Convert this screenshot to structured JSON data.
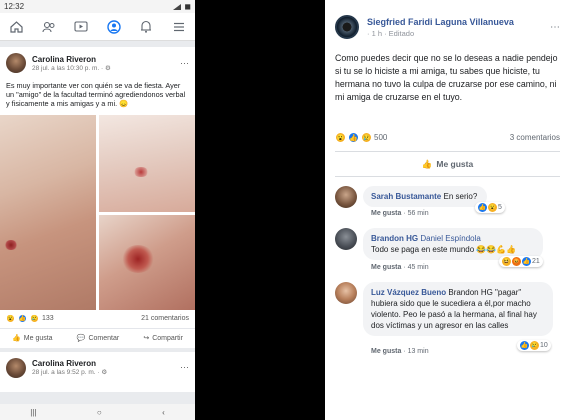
{
  "left": {
    "status": {
      "time": "12:32",
      "battery": "◼"
    },
    "nav": [
      "home-icon",
      "friends-icon",
      "watch-icon",
      "profile-icon",
      "notifications-icon",
      "menu-icon"
    ],
    "post": {
      "author": "Carolina Riveron",
      "time": "28 jul. a las 10:30 p. m. · ⚙",
      "text": "Es muy importante ver con quién se va de fiesta. Ayer un \"amigo\" de la facultad terminó agrediendonos verbal y fisicamente a mis amigas y a mi. 😞",
      "reaction_count": "133",
      "comments": "21 comentarios",
      "actions": {
        "like": "Me gusta",
        "comment": "Comentar",
        "share": "Compartir"
      }
    },
    "post2": {
      "author": "Carolina Riveron",
      "time": "28 jul. a las 9:52 p. m. · ⚙"
    }
  },
  "right": {
    "author": "Siegfried Faridi Laguna Villanueva",
    "time": "· 1 h · Editado",
    "text": "Como puedes decir que no se lo deseas a nadie pendejo si tu se lo hiciste a mi amiga, tu sabes que hiciste, tu hermana no tuvo la culpa de cruzarse por ese camino, ni mi amiga de cruzarse en el tuyo.",
    "reaction_count": "500",
    "comments_count": "3 comentarios",
    "like_label": "Me gusta",
    "comments": [
      {
        "name": "Sarah Bustamante",
        "text": "En serio?",
        "like": "Me gusta",
        "time": "56 min",
        "reacts": "5"
      },
      {
        "name": "Brandon HG",
        "mention": "Daniel Espíndola",
        "text": "Todo se paga en este mundo 😂😂💪👍",
        "like": "Me gusta",
        "time": "45 min",
        "reacts": "21"
      },
      {
        "name": "Luz Vázquez Bueno",
        "text": "Brandon HG \"pagar\" hubiera sido que le sucediera a él,por macho violento. Peo le pasó a la hermana, al final hay dos víctimas y un agresor en las calles",
        "like": "Me gusta",
        "time": "13 min",
        "reacts": "10"
      }
    ]
  }
}
